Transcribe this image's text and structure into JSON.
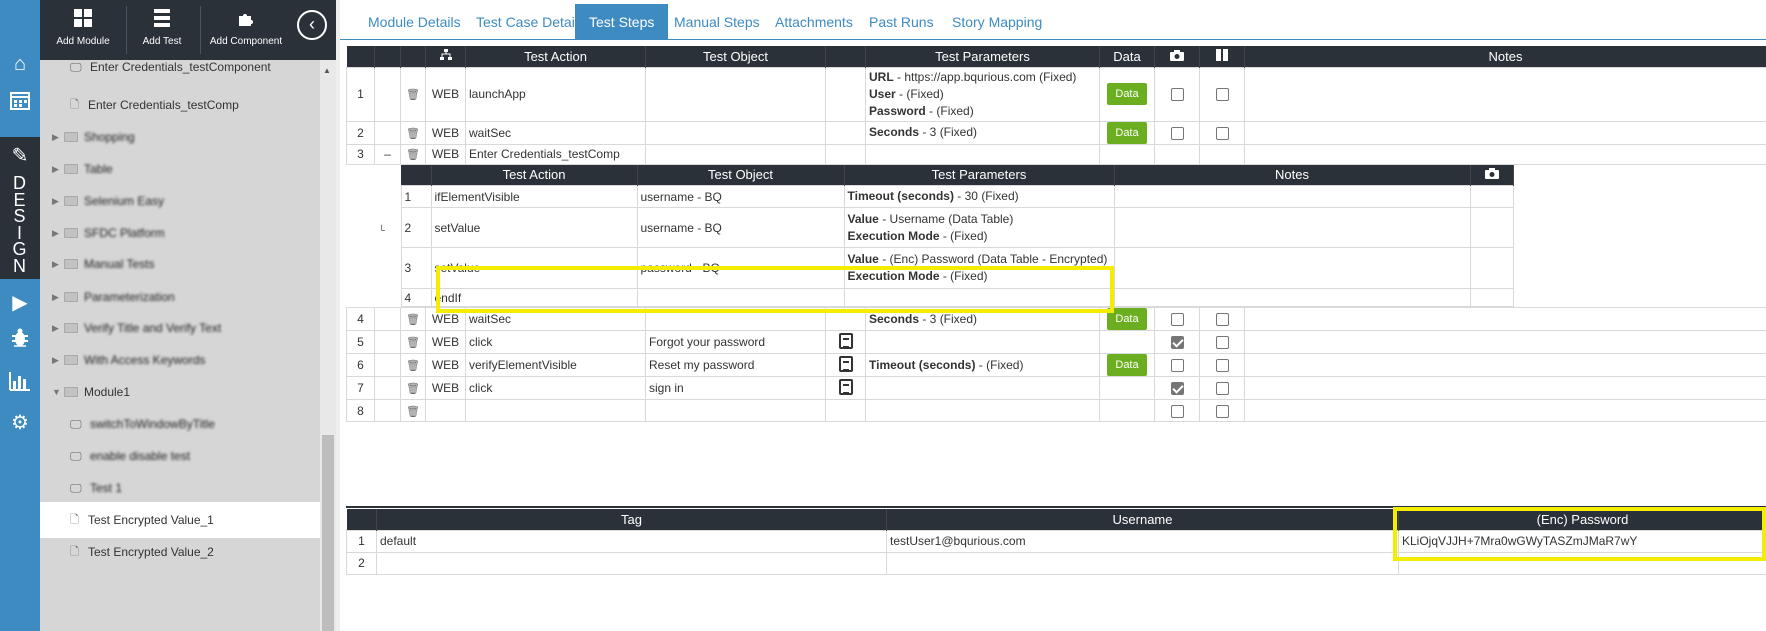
{
  "toolbar": {
    "add_module": "Add Module",
    "add_test": "Add Test",
    "add_component": "Add Component"
  },
  "rail": {
    "design_letters": [
      "D",
      "E",
      "S",
      "I",
      "G",
      "N"
    ]
  },
  "tree": {
    "items": [
      {
        "label": "Enter Credentials_testComponent",
        "type": "test"
      },
      {
        "label": "Enter Credentials_testComp",
        "type": "doc"
      },
      {
        "label": "Shopping",
        "type": "folder-blurred"
      },
      {
        "label": "Table",
        "type": "folder-blurred"
      },
      {
        "label": "Selenium Easy",
        "type": "folder-blurred"
      },
      {
        "label": "SFDC Platform",
        "type": "folder-blurred"
      },
      {
        "label": "Manual Tests",
        "type": "folder-blurred"
      },
      {
        "label": "Parameterization",
        "type": "folder-blurred"
      },
      {
        "label": "Verify Title and Verify Text",
        "type": "folder-blurred"
      },
      {
        "label": "With Access Keywords",
        "type": "folder-blurred"
      },
      {
        "label": "Module1",
        "type": "folder-open"
      },
      {
        "label": "switchToWindowByTitle",
        "type": "test-blurred"
      },
      {
        "label": "enable disable test",
        "type": "test-blurred"
      },
      {
        "label": "Test 1",
        "type": "test-blurred"
      },
      {
        "label": "Test Encrypted Value_1",
        "type": "doc",
        "selected": true
      },
      {
        "label": "Test Encrypted Value_2",
        "type": "doc"
      }
    ]
  },
  "tabs": [
    "Module Details",
    "Test Case Detail",
    "Test Steps",
    "Manual Steps",
    "Attachments",
    "Past Runs",
    "Story Mapping"
  ],
  "active_tab": "Test Steps",
  "steps": {
    "headers": {
      "action": "Test Action",
      "object": "Test Object",
      "params": "Test Parameters",
      "data": "Data",
      "notes": "Notes"
    },
    "data_button": "Data",
    "rows": [
      {
        "num": "1",
        "type": "WEB",
        "action": "launchApp",
        "object": "",
        "params": [
          [
            "URL",
            " - https://app.bqurious.com (Fixed)"
          ],
          [
            "User",
            " -  (Fixed)"
          ],
          [
            "Password",
            " -  (Fixed)"
          ]
        ],
        "data": true,
        "screenshot": false
      },
      {
        "num": "2",
        "type": "WEB",
        "action": "waitSec",
        "object": "",
        "params": [
          [
            "Seconds",
            " - 3 (Fixed)"
          ]
        ],
        "data": true,
        "screenshot": false
      },
      {
        "num": "3",
        "toggle": "–",
        "type": "WEB",
        "action": "Enter Credentials_testComp",
        "object": "",
        "params": [],
        "data": false,
        "screenshot": false
      },
      {
        "num": "4",
        "type": "WEB",
        "action": "waitSec",
        "object": "",
        "params": [
          [
            "Seconds",
            " - 3 (Fixed)"
          ]
        ],
        "data": true,
        "screenshot": false
      },
      {
        "num": "5",
        "type": "WEB",
        "action": "click",
        "object": "Forgot your password",
        "note": true,
        "params": [],
        "data": false,
        "screenshot": true
      },
      {
        "num": "6",
        "type": "WEB",
        "action": "verifyElementVisible",
        "object": "Reset my password",
        "note": true,
        "params": [
          [
            "Timeout (seconds)",
            " -  (Fixed)"
          ]
        ],
        "data": true,
        "screenshot": false
      },
      {
        "num": "7",
        "type": "WEB",
        "action": "click",
        "object": "sign in",
        "note": true,
        "params": [],
        "data": false,
        "screenshot": true
      },
      {
        "num": "8",
        "type": "",
        "action": "",
        "object": "",
        "params": [],
        "data": false,
        "screenshot": false
      }
    ]
  },
  "component": {
    "headers": {
      "action": "Test Action",
      "object": "Test Object",
      "params": "Test Parameters",
      "notes": "Notes"
    },
    "rows": [
      {
        "num": "1",
        "action": "ifElementVisible",
        "object": "username  - BQ",
        "params": [
          [
            "Timeout (seconds)",
            " - 30 (Fixed)"
          ]
        ]
      },
      {
        "num": "2",
        "action": "setValue",
        "object": "username  - BQ",
        "params": [
          [
            "Value",
            " - Username (Data Table)"
          ],
          [
            "Execution Mode",
            " -  (Fixed)"
          ]
        ]
      },
      {
        "num": "3",
        "action": "setValue",
        "object": "password - BQ",
        "params": [
          [
            "Value",
            " - (Enc) Password (Data Table - Encrypted)"
          ],
          [
            "Execution Mode",
            " -  (Fixed)"
          ]
        ]
      },
      {
        "num": "4",
        "action": "endIf",
        "object": "",
        "params": []
      }
    ]
  },
  "data_table": {
    "headers": [
      "Tag",
      "Username",
      "(Enc) Password"
    ],
    "rows": [
      {
        "num": "1",
        "tag": "default",
        "username": "testUser1@bqurious.com",
        "password": "KLiOjqVJJH+7Mra0wGWyTASZmJMaR7wY"
      },
      {
        "num": "2",
        "tag": "",
        "username": "",
        "password": ""
      }
    ]
  },
  "colors": {
    "accent": "#3e8bc2",
    "dark": "#2a3138",
    "data_button": "#6bae20",
    "highlight": "#f4ed00"
  }
}
